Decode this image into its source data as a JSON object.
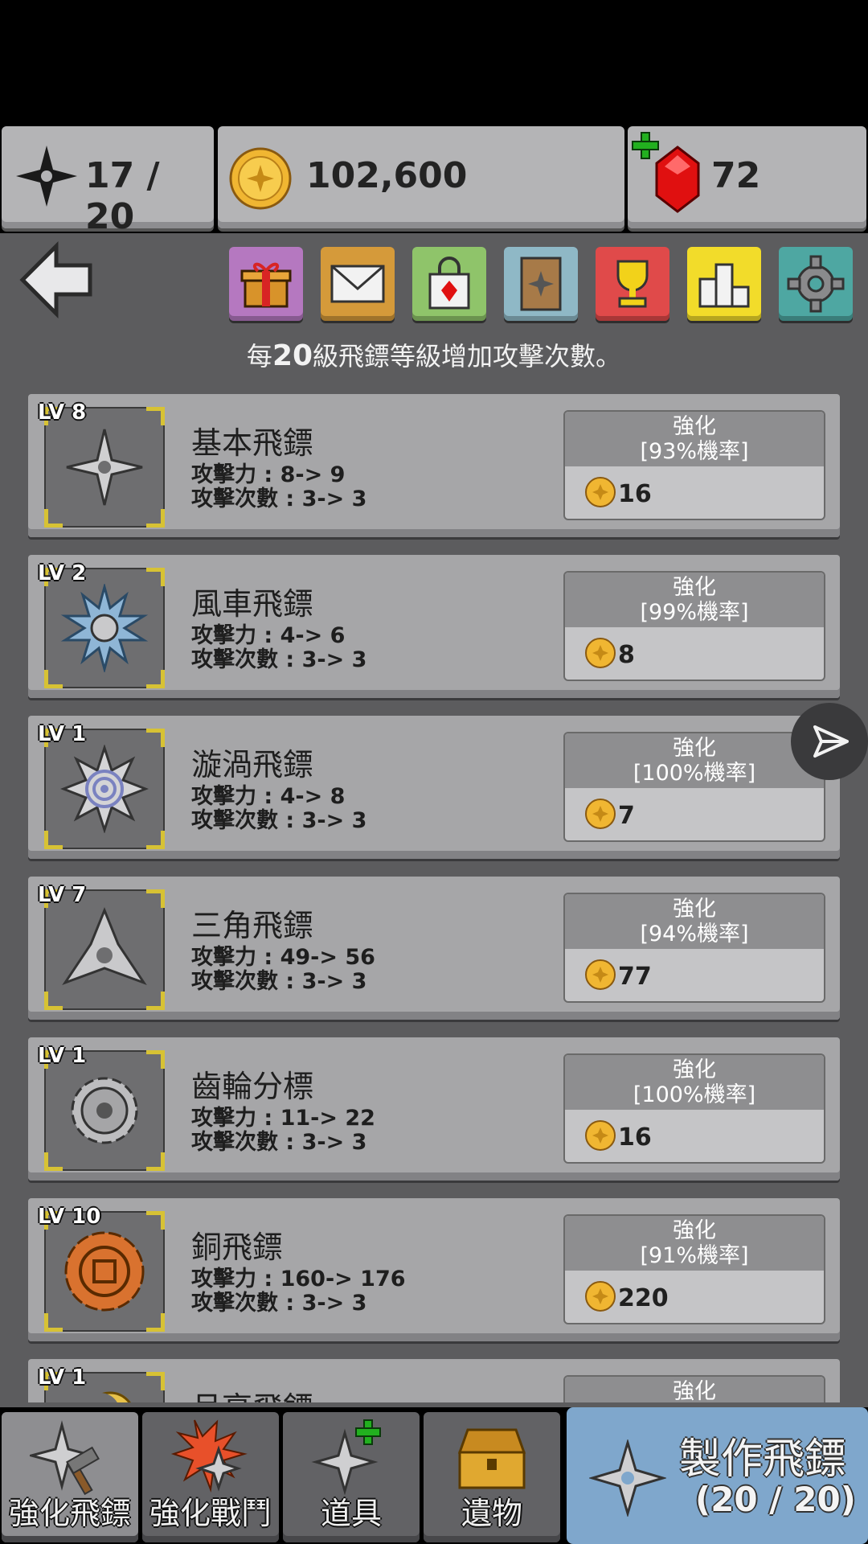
{
  "resources": {
    "shuriken_count": "17 / 20",
    "gold": "102,600",
    "gems": "72"
  },
  "menu_icons": [
    "gift-icon",
    "mail-icon",
    "shop-icon",
    "codex-icon",
    "trophy-icon",
    "ranking-icon",
    "gear-icon"
  ],
  "notice": {
    "prefix": "每",
    "highlight": "20",
    "suffix": "級飛鏢等級增加攻擊次數。"
  },
  "shurikens": [
    {
      "level": "LV 8",
      "name": "基本飛鏢",
      "attack": "攻擊力 : 8-> 9",
      "hits": "攻擊次數 : 3-> 3",
      "upgrade_label": "強化",
      "chance": "[93%機率]",
      "cost": "16",
      "color": "#cfcfd1"
    },
    {
      "level": "LV 2",
      "name": "風車飛鏢",
      "attack": "攻擊力 : 4-> 6",
      "hits": "攻擊次數 : 3-> 3",
      "upgrade_label": "強化",
      "chance": "[99%機率]",
      "cost": "8",
      "color": "#8fb6d6"
    },
    {
      "level": "LV 1",
      "name": "漩渦飛鏢",
      "attack": "攻擊力 : 4-> 8",
      "hits": "攻擊次數 : 3-> 3",
      "upgrade_label": "強化",
      "chance": "[100%機率]",
      "cost": "7",
      "color": "#9aa3c9"
    },
    {
      "level": "LV 7",
      "name": "三角飛鏢",
      "attack": "攻擊力 : 49-> 56",
      "hits": "攻擊次數 : 3-> 3",
      "upgrade_label": "強化",
      "chance": "[94%機率]",
      "cost": "77",
      "color": "#c9c9cb"
    },
    {
      "level": "LV 1",
      "name": "齒輪分標",
      "attack": "攻擊力 : 11-> 22",
      "hits": "攻擊次數 : 3-> 3",
      "upgrade_label": "強化",
      "chance": "[100%機率]",
      "cost": "16",
      "color": "#bdbdbf"
    },
    {
      "level": "LV 10",
      "name": "銅飛鏢",
      "attack": "攻擊力 : 160-> 176",
      "hits": "攻擊次數 : 3-> 3",
      "upgrade_label": "強化",
      "chance": "[91%機率]",
      "cost": "220",
      "color": "#d9722f"
    },
    {
      "level": "LV 1",
      "name": "月亮飛鏢",
      "attack": "",
      "hits": "",
      "upgrade_label": "強化",
      "chance": "",
      "cost": "",
      "color": "#e8c24a"
    }
  ],
  "bottom_tabs": [
    {
      "label": "強化飛鏢"
    },
    {
      "label": "強化戰鬥"
    },
    {
      "label": "道具"
    },
    {
      "label": "遺物"
    }
  ],
  "craft": {
    "title": "製作飛鏢",
    "count": "(20 / 20)"
  }
}
